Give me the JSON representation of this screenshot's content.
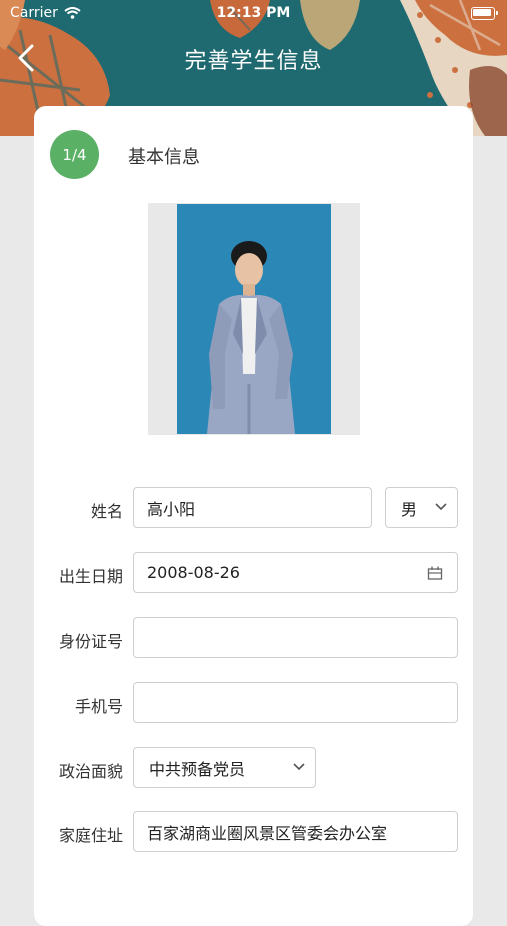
{
  "status_bar": {
    "carrier": "Carrier",
    "time": "12:13 PM"
  },
  "nav": {
    "title": "完善学生信息"
  },
  "step": {
    "badge": "1/4",
    "title": "基本信息"
  },
  "form": {
    "name": {
      "label": "姓名",
      "value": "高小阳"
    },
    "gender": {
      "value": "男"
    },
    "birth_date": {
      "label": "出生日期",
      "value": "2008-08-26"
    },
    "id_number": {
      "label": "身份证号",
      "value": ""
    },
    "phone": {
      "label": "手机号",
      "value": ""
    },
    "political_status": {
      "label": "政治面貌",
      "value": "中共预备党员"
    },
    "address": {
      "label": "家庭住址",
      "value": "百家湖商业圈风景区管委会办公室"
    }
  },
  "colors": {
    "header_teal": "#1e6a70",
    "leaf_orange": "#cc7040",
    "step_green": "#5ab064",
    "photo_blue": "#2f8fbf",
    "background": "#e9e9e9"
  }
}
